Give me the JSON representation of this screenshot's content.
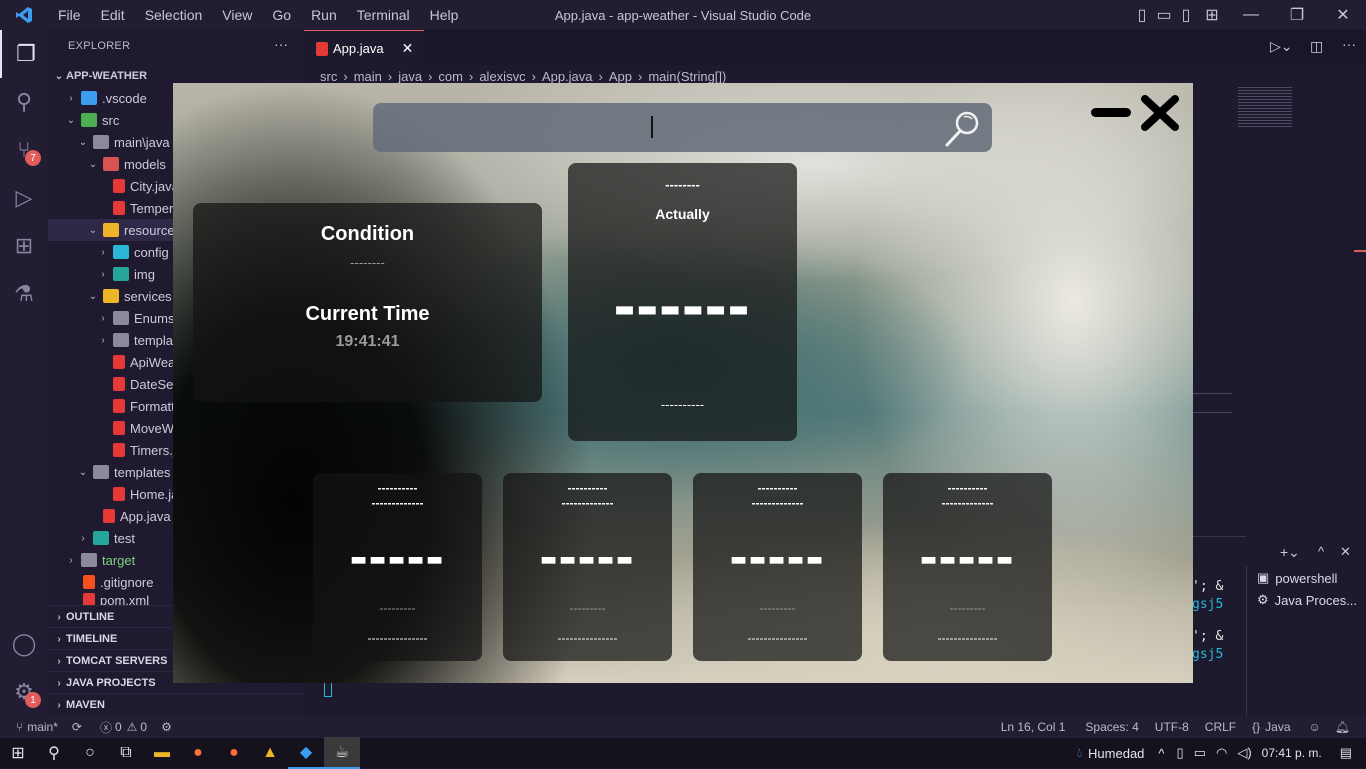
{
  "titlebar": {
    "menus": [
      "File",
      "Edit",
      "Selection",
      "View",
      "Go",
      "Run",
      "Terminal",
      "Help"
    ],
    "window_title": "App.java - app-weather - Visual Studio Code"
  },
  "activitybar": {
    "scm_badge": "7",
    "settings_badge": "1"
  },
  "sidebar": {
    "title": "EXPLORER",
    "root": "APP-WEATHER",
    "tree": [
      {
        "label": ".vscode"
      },
      {
        "label": "src"
      },
      {
        "label": "main\\java"
      },
      {
        "label": "models"
      },
      {
        "label": "City.java"
      },
      {
        "label": "Tempera"
      },
      {
        "label": "resources"
      },
      {
        "label": "config"
      },
      {
        "label": "img"
      },
      {
        "label": "services"
      },
      {
        "label": "Enums"
      },
      {
        "label": "templat"
      },
      {
        "label": "ApiWea"
      },
      {
        "label": "DateSer"
      },
      {
        "label": "Formatt"
      },
      {
        "label": "MoveW"
      },
      {
        "label": "Timers.j"
      },
      {
        "label": "templates"
      },
      {
        "label": "Home.ja"
      },
      {
        "label": "App.java"
      },
      {
        "label": "test"
      },
      {
        "label": "target"
      },
      {
        "label": ".gitignore"
      },
      {
        "label": "pom.xml"
      }
    ],
    "sections": [
      "OUTLINE",
      "TIMELINE",
      "TOMCAT SERVERS",
      "JAVA PROJECTS",
      "MAVEN"
    ]
  },
  "editor": {
    "tab_label": "App.java",
    "breadcrumb": [
      "src",
      "main",
      "java",
      "com",
      "alexisvc",
      "App.java",
      "App",
      "main(String[])"
    ],
    "code_fragments": [
      "'; &",
      "gsj5",
      "'; &",
      "gsj5"
    ]
  },
  "panel": {
    "terminals": [
      "powershell",
      "Java Proces..."
    ]
  },
  "statusbar": {
    "branch": "main*",
    "errors": "0",
    "warnings": "0",
    "position": "Ln 16, Col 1",
    "spaces": "Spaces: 4",
    "encoding": "UTF-8",
    "eol": "CRLF",
    "language": "Java"
  },
  "taskbar": {
    "weather": "Humedad",
    "time": "07:41 p. m."
  },
  "weather_app": {
    "search_placeholder": "",
    "condition_title": "Condition",
    "condition_value": "--------",
    "current_time_title": "Current Time",
    "current_time_value": "19:41:41",
    "main_card": {
      "top": "--------",
      "label": "Actually",
      "temp": "▬▬▬▬▬▬",
      "bottom": "----------"
    },
    "forecast": [
      {
        "line1": "----------",
        "line2": "-------------",
        "temp": "▬▬▬▬▬",
        "line3": "---------",
        "line4": "---------------"
      },
      {
        "line1": "----------",
        "line2": "-------------",
        "temp": "▬▬▬▬▬",
        "line3": "---------",
        "line4": "---------------"
      },
      {
        "line1": "----------",
        "line2": "-------------",
        "temp": "▬▬▬▬▬",
        "line3": "---------",
        "line4": "---------------"
      },
      {
        "line1": "----------",
        "line2": "-------------",
        "temp": "▬▬▬▬▬",
        "line3": "---------",
        "line4": "---------------"
      }
    ]
  }
}
